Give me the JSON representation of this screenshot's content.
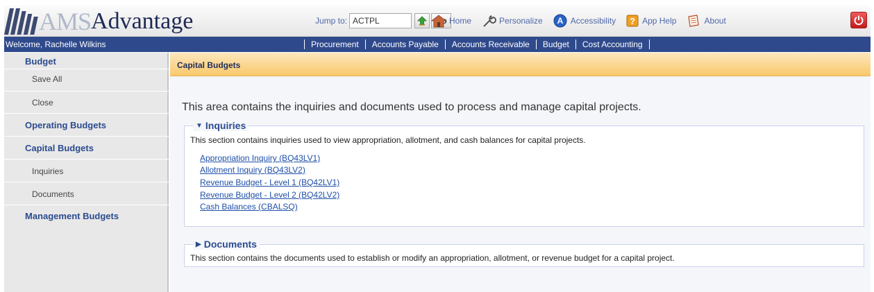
{
  "logo": {
    "ams": "AMS",
    "advantage": "Advantage"
  },
  "jump": {
    "label": "Jump to:",
    "value": "ACTPL",
    "go_label": "Go"
  },
  "toplinks": [
    {
      "label": "Home",
      "icon": "home-icon"
    },
    {
      "label": "Personalize",
      "icon": "wrench-icon"
    },
    {
      "label": "Accessibility",
      "icon": "accessibility-icon"
    },
    {
      "label": "App Help",
      "icon": "help-icon"
    },
    {
      "label": "About",
      "icon": "about-icon"
    }
  ],
  "welcome": "Welcome, Rachelle Wilkins",
  "navmenu": [
    "Procurement",
    "Accounts Payable",
    "Accounts Receivable",
    "Budget",
    "Cost Accounting"
  ],
  "sidebar": {
    "title": "Budget",
    "items": [
      {
        "label": "Save All",
        "type": "sub"
      },
      {
        "label": "Close",
        "type": "sub"
      },
      {
        "label": "Operating Budgets",
        "type": "head"
      },
      {
        "label": "Capital Budgets",
        "type": "head"
      },
      {
        "label": "Inquiries",
        "type": "sub"
      },
      {
        "label": "Documents",
        "type": "sub"
      },
      {
        "label": "Management Budgets",
        "type": "head"
      }
    ]
  },
  "content": {
    "title": "Capital Budgets",
    "intro": "This area contains the inquiries and documents used to process and manage capital projects.",
    "inquiries": {
      "legend": "Inquiries",
      "description": "This section contains inquiries used to view appropriation, allotment, and cash balances for capital projects.",
      "links": [
        "Appropriation Inquiry (BQ43LV1)",
        "Allotment Inquiry (BQ43LV2)",
        "Revenue Budget - Level 1 (BQ42LV1)",
        "Revenue Budget - Level 2 (BQ42LV2)",
        "Cash Balances (CBALSQ)"
      ]
    },
    "documents": {
      "legend": "Documents",
      "description": "This section contains the documents used to establish or modify an appropriation, allotment, or revenue budget for a capital project."
    }
  },
  "colors": {
    "navbar": "#2f4a8c",
    "sidebar": "#e8e8e8",
    "title_bar": "#f9c86a",
    "link": "#1e4fa8"
  }
}
